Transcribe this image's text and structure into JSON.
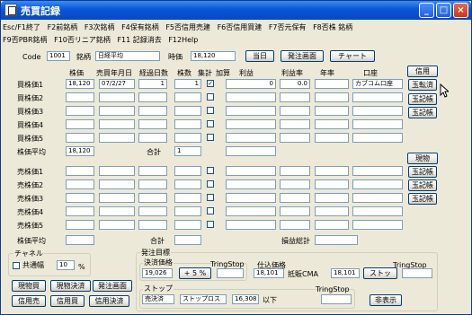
{
  "window": {
    "title": "売買記録"
  },
  "menu_row1": [
    "Esc/F1終了",
    "F2前銘柄",
    "F3次銘柄",
    "F4保有銘柄",
    "F5否信用売建",
    "F6否信用買建",
    "F7否元保有",
    "F8否株 銘柄"
  ],
  "menu_row2": [
    "F9否PBR銘柄",
    "F10否リニア銘柄",
    "F11 記録消去",
    "F12Help"
  ],
  "header": {
    "code_label": "Code",
    "code_value": "1001",
    "meigara_label": "銘柄",
    "meigara_value": "日経平均",
    "jika_label": "時価",
    "jika_value": "18,120",
    "today_btn": "当日",
    "order_btn": "発注画面",
    "chart_btn": "チャート"
  },
  "columns": {
    "price": "株価",
    "date": "売買年月日",
    "days": "経過日数",
    "shares": "株数",
    "aggregate": "集計",
    "add": "加算",
    "profit": "利益",
    "rate": "利益率",
    "annual": "年率",
    "account": "口座"
  },
  "buy_rows": [
    {
      "label": "買株価1",
      "price": "18,120",
      "date": "07/2/27",
      "days": "1",
      "shares": "1",
      "checked": "✓",
      "profit": "0",
      "rate": "0.0",
      "annual": "",
      "account": "カブコム口座"
    },
    {
      "label": "買株価2",
      "price": "",
      "date": "",
      "days": "",
      "shares": "",
      "checked": "",
      "profit": "",
      "rate": "",
      "annual": "",
      "account": ""
    },
    {
      "label": "買株価3",
      "price": "",
      "date": "",
      "days": "",
      "shares": "",
      "checked": "",
      "profit": "",
      "rate": "",
      "annual": "",
      "account": ""
    },
    {
      "label": "買株価4",
      "price": "",
      "date": "",
      "days": "",
      "shares": "",
      "checked": "",
      "profit": "",
      "rate": "",
      "annual": "",
      "account": ""
    },
    {
      "label": "買株価5",
      "price": "",
      "date": "",
      "days": "",
      "shares": "",
      "checked": "",
      "profit": "",
      "rate": "",
      "annual": "",
      "account": ""
    }
  ],
  "buy_avg": {
    "label": "株価平均",
    "value": "18,120",
    "total_label": "合計",
    "total_value": "1"
  },
  "sell_rows": [
    {
      "label": "売株価1"
    },
    {
      "label": "売株価2"
    },
    {
      "label": "売株価3"
    },
    {
      "label": "売株価4"
    },
    {
      "label": "売株価5"
    }
  ],
  "sell_avg": {
    "label": "株価平均",
    "value": "",
    "total_label": "合計",
    "total_value": "",
    "profit_total_label": "損益総計",
    "profit_total_value": ""
  },
  "side_shinyo": {
    "label": "信用",
    "btns": [
      "玉転済",
      "玉記帳",
      "玉記帳"
    ]
  },
  "side_genbutsu": {
    "label": "現物",
    "btns": [
      "玉記帳",
      "玉記帳",
      "玉記帳"
    ]
  },
  "channel": {
    "title": "チャネル",
    "kyotsu_label": "共通幅",
    "width_value": "10",
    "pct": "%"
  },
  "bottom_btns": [
    "現物買",
    "現物決済",
    "発注画面",
    "信用売",
    "信用買",
    "信用決済"
  ],
  "order_target": {
    "title": "発注目標",
    "settle_label": "決済価格",
    "settle_value": "19,026",
    "plus_pct": "+ 5 %",
    "tring_label1": "TringStop",
    "tring_value1": "",
    "shikomi_label": "仕込価格",
    "shikomi_value": "18,101",
    "hitoku_label": "抵販CMA",
    "hitoku_value": "18,101",
    "stoku_btn": "ストッ",
    "tring_label2": "TringStop",
    "tring_value2": "",
    "stop_title": "ストップ",
    "sell_settle": "売決済",
    "stoploss": "ストップロス",
    "stop_value": "16,308",
    "below": "以下",
    "tring_label3": "TringStop",
    "tring_value3": "",
    "hide_btn": "非表示"
  }
}
